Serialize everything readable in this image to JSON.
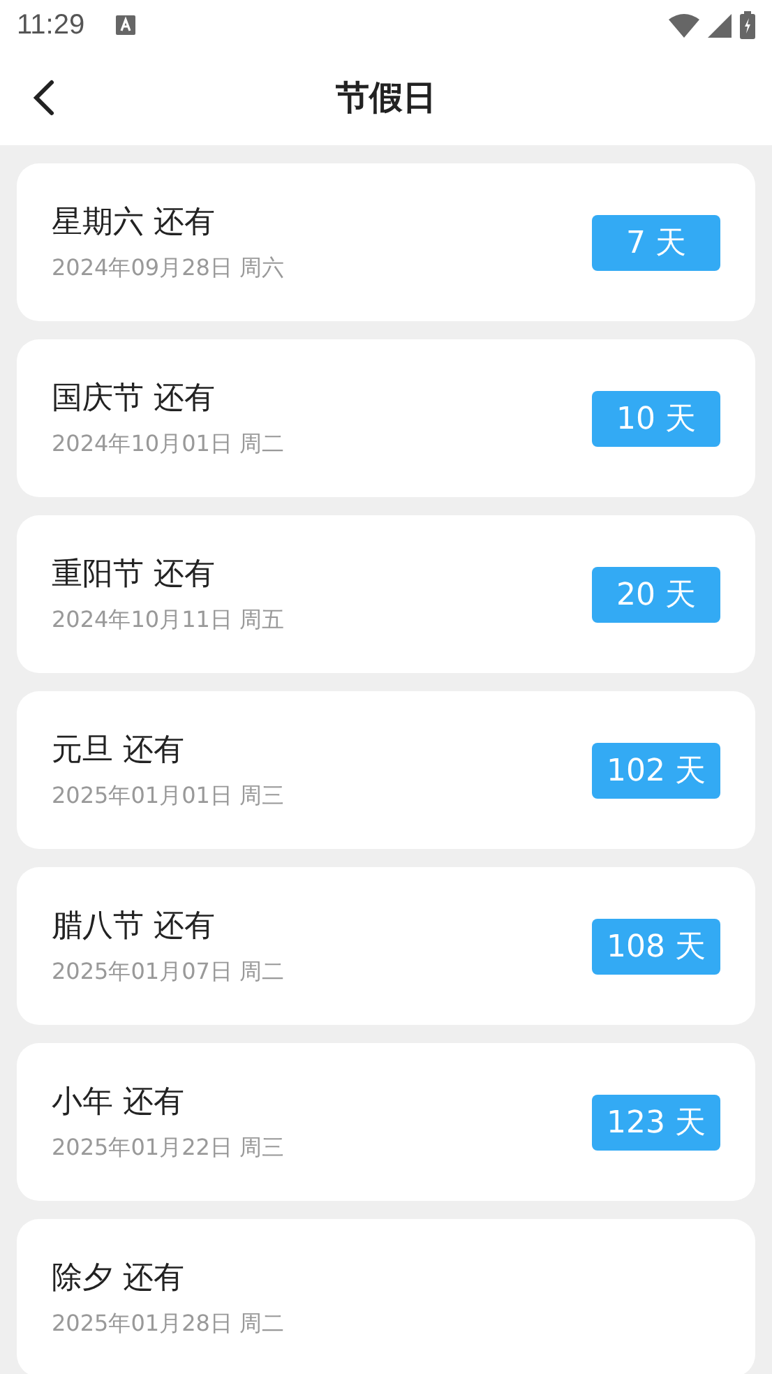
{
  "status_bar": {
    "time": "11:29"
  },
  "header": {
    "title": "节假日"
  },
  "holidays": [
    {
      "title": "星期六 还有",
      "date": "2024年09月28日 周六",
      "days": "7 天"
    },
    {
      "title": "国庆节 还有",
      "date": "2024年10月01日 周二",
      "days": "10 天"
    },
    {
      "title": "重阳节 还有",
      "date": "2024年10月11日 周五",
      "days": "20 天"
    },
    {
      "title": "元旦 还有",
      "date": "2025年01月01日 周三",
      "days": "102 天"
    },
    {
      "title": "腊八节 还有",
      "date": "2025年01月07日 周二",
      "days": "108 天"
    },
    {
      "title": "小年 还有",
      "date": "2025年01月22日 周三",
      "days": "123 天"
    },
    {
      "title": "除夕 还有",
      "date": "2025年01月28日 周二"
    }
  ]
}
